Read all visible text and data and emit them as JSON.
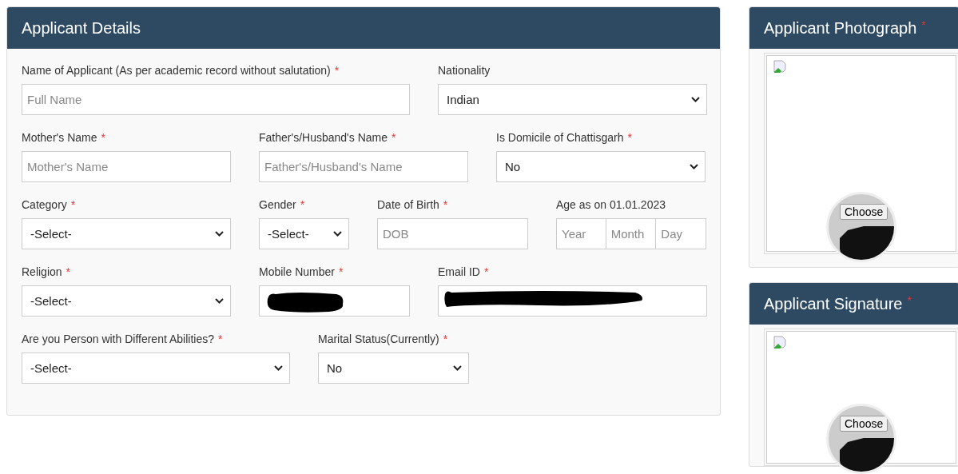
{
  "main_panel": {
    "title": "Applicant Details",
    "form_lines": [
      {
        "fields": [
          {
            "label": "Name of Applicant (As per academic record without salutation)",
            "required_mark": "*",
            "kind": "text",
            "placeholder": "Full Name"
          },
          {
            "label": "Nationality",
            "kind": "select",
            "value": "Indian"
          }
        ]
      },
      {
        "fields": [
          {
            "label": "Mother's Name",
            "required_mark": "*",
            "kind": "text",
            "placeholder": "Mother's Name"
          },
          {
            "label": "Father's/Husband's Name",
            "required_mark": "*",
            "kind": "text",
            "placeholder": "Father's/Husband's Name"
          },
          {
            "label": "Is Domicile of Chattisgarh",
            "required_mark": "*",
            "kind": "select",
            "value": "No"
          }
        ]
      },
      {
        "fields": [
          {
            "label": "Category",
            "required_mark": "*",
            "kind": "select",
            "value": "-Select-"
          },
          {
            "label": "Gender",
            "required_mark": "*",
            "kind": "select",
            "value": "-Select-"
          },
          {
            "label": "Date of Birth",
            "required_mark": "*",
            "kind": "text",
            "placeholder": "DOB"
          },
          {
            "label": "Age as on 01.01.2023",
            "kind": "age",
            "parts": [
              {
                "placeholder": "Year"
              },
              {
                "placeholder": "Month"
              },
              {
                "placeholder": "Day"
              }
            ]
          }
        ]
      },
      {
        "fields": [
          {
            "label": "Religion",
            "required_mark": "*",
            "kind": "select",
            "value": "-Select-"
          },
          {
            "label": "Mobile Number",
            "required_mark": "*",
            "kind": "redacted"
          },
          {
            "label": "Email ID",
            "required_mark": "*",
            "kind": "redacted"
          }
        ]
      },
      {
        "fields": [
          {
            "label": "Are you Person with Different Abilities?",
            "required_mark": "*",
            "kind": "select",
            "value": "-Select-"
          },
          {
            "label": "Marital Status(Currently)",
            "required_mark": "*",
            "kind": "select",
            "value": "No"
          }
        ]
      }
    ]
  },
  "side_panels": [
    {
      "title": "Applicant Photograph",
      "required_mark": "*",
      "button": "Choose"
    },
    {
      "title": "Applicant Signature",
      "required_mark": "*",
      "button": "Choose"
    }
  ]
}
